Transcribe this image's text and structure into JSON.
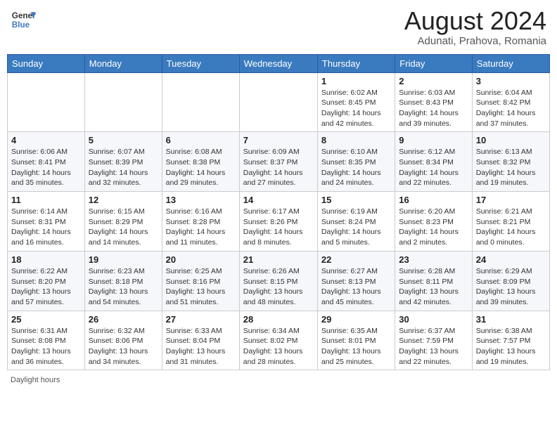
{
  "header": {
    "logo_line1": "General",
    "logo_line2": "Blue",
    "month_year": "August 2024",
    "location": "Adunati, Prahova, Romania"
  },
  "days_of_week": [
    "Sunday",
    "Monday",
    "Tuesday",
    "Wednesday",
    "Thursday",
    "Friday",
    "Saturday"
  ],
  "weeks": [
    [
      {
        "day": "",
        "info": ""
      },
      {
        "day": "",
        "info": ""
      },
      {
        "day": "",
        "info": ""
      },
      {
        "day": "",
        "info": ""
      },
      {
        "day": "1",
        "info": "Sunrise: 6:02 AM\nSunset: 8:45 PM\nDaylight: 14 hours and 42 minutes."
      },
      {
        "day": "2",
        "info": "Sunrise: 6:03 AM\nSunset: 8:43 PM\nDaylight: 14 hours and 39 minutes."
      },
      {
        "day": "3",
        "info": "Sunrise: 6:04 AM\nSunset: 8:42 PM\nDaylight: 14 hours and 37 minutes."
      }
    ],
    [
      {
        "day": "4",
        "info": "Sunrise: 6:06 AM\nSunset: 8:41 PM\nDaylight: 14 hours and 35 minutes."
      },
      {
        "day": "5",
        "info": "Sunrise: 6:07 AM\nSunset: 8:39 PM\nDaylight: 14 hours and 32 minutes."
      },
      {
        "day": "6",
        "info": "Sunrise: 6:08 AM\nSunset: 8:38 PM\nDaylight: 14 hours and 29 minutes."
      },
      {
        "day": "7",
        "info": "Sunrise: 6:09 AM\nSunset: 8:37 PM\nDaylight: 14 hours and 27 minutes."
      },
      {
        "day": "8",
        "info": "Sunrise: 6:10 AM\nSunset: 8:35 PM\nDaylight: 14 hours and 24 minutes."
      },
      {
        "day": "9",
        "info": "Sunrise: 6:12 AM\nSunset: 8:34 PM\nDaylight: 14 hours and 22 minutes."
      },
      {
        "day": "10",
        "info": "Sunrise: 6:13 AM\nSunset: 8:32 PM\nDaylight: 14 hours and 19 minutes."
      }
    ],
    [
      {
        "day": "11",
        "info": "Sunrise: 6:14 AM\nSunset: 8:31 PM\nDaylight: 14 hours and 16 minutes."
      },
      {
        "day": "12",
        "info": "Sunrise: 6:15 AM\nSunset: 8:29 PM\nDaylight: 14 hours and 14 minutes."
      },
      {
        "day": "13",
        "info": "Sunrise: 6:16 AM\nSunset: 8:28 PM\nDaylight: 14 hours and 11 minutes."
      },
      {
        "day": "14",
        "info": "Sunrise: 6:17 AM\nSunset: 8:26 PM\nDaylight: 14 hours and 8 minutes."
      },
      {
        "day": "15",
        "info": "Sunrise: 6:19 AM\nSunset: 8:24 PM\nDaylight: 14 hours and 5 minutes."
      },
      {
        "day": "16",
        "info": "Sunrise: 6:20 AM\nSunset: 8:23 PM\nDaylight: 14 hours and 2 minutes."
      },
      {
        "day": "17",
        "info": "Sunrise: 6:21 AM\nSunset: 8:21 PM\nDaylight: 14 hours and 0 minutes."
      }
    ],
    [
      {
        "day": "18",
        "info": "Sunrise: 6:22 AM\nSunset: 8:20 PM\nDaylight: 13 hours and 57 minutes."
      },
      {
        "day": "19",
        "info": "Sunrise: 6:23 AM\nSunset: 8:18 PM\nDaylight: 13 hours and 54 minutes."
      },
      {
        "day": "20",
        "info": "Sunrise: 6:25 AM\nSunset: 8:16 PM\nDaylight: 13 hours and 51 minutes."
      },
      {
        "day": "21",
        "info": "Sunrise: 6:26 AM\nSunset: 8:15 PM\nDaylight: 13 hours and 48 minutes."
      },
      {
        "day": "22",
        "info": "Sunrise: 6:27 AM\nSunset: 8:13 PM\nDaylight: 13 hours and 45 minutes."
      },
      {
        "day": "23",
        "info": "Sunrise: 6:28 AM\nSunset: 8:11 PM\nDaylight: 13 hours and 42 minutes."
      },
      {
        "day": "24",
        "info": "Sunrise: 6:29 AM\nSunset: 8:09 PM\nDaylight: 13 hours and 39 minutes."
      }
    ],
    [
      {
        "day": "25",
        "info": "Sunrise: 6:31 AM\nSunset: 8:08 PM\nDaylight: 13 hours and 36 minutes."
      },
      {
        "day": "26",
        "info": "Sunrise: 6:32 AM\nSunset: 8:06 PM\nDaylight: 13 hours and 34 minutes."
      },
      {
        "day": "27",
        "info": "Sunrise: 6:33 AM\nSunset: 8:04 PM\nDaylight: 13 hours and 31 minutes."
      },
      {
        "day": "28",
        "info": "Sunrise: 6:34 AM\nSunset: 8:02 PM\nDaylight: 13 hours and 28 minutes."
      },
      {
        "day": "29",
        "info": "Sunrise: 6:35 AM\nSunset: 8:01 PM\nDaylight: 13 hours and 25 minutes."
      },
      {
        "day": "30",
        "info": "Sunrise: 6:37 AM\nSunset: 7:59 PM\nDaylight: 13 hours and 22 minutes."
      },
      {
        "day": "31",
        "info": "Sunrise: 6:38 AM\nSunset: 7:57 PM\nDaylight: 13 hours and 19 minutes."
      }
    ]
  ],
  "footer": {
    "daylight_label": "Daylight hours"
  }
}
